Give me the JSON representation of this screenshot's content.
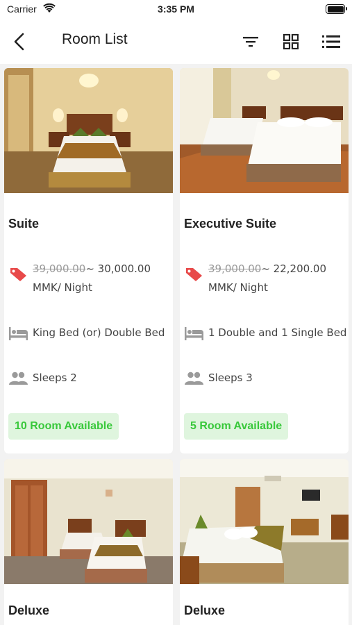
{
  "status_bar": {
    "carrier": "Carrier",
    "time": "3:35 PM"
  },
  "nav": {
    "title": "Room List"
  },
  "rooms": [
    {
      "name": "Suite",
      "old_price": "39,000.00",
      "new_price": "~ 30,000.00 MMK/ Night",
      "bed": "King Bed (or) Double Bed",
      "sleeps": "Sleeps 2",
      "availability": "10 Room Available"
    },
    {
      "name": "Executive Suite",
      "old_price": "39,000.00",
      "new_price": "~ 22,200.00 MMK/ Night",
      "bed": "1 Double and 1 Single Bed",
      "sleeps": "Sleeps 3",
      "availability": "5 Room Available"
    },
    {
      "name": "Deluxe"
    },
    {
      "name": "Deluxe"
    }
  ],
  "colors": {
    "available_bg": "#dff5de",
    "available_text": "#38c83a",
    "price_tag": "#e84a4a",
    "icon_gray": "#9a9a9a"
  }
}
